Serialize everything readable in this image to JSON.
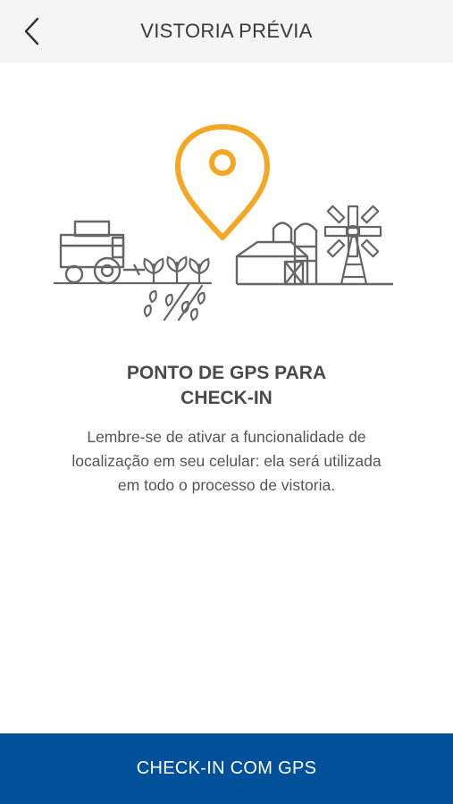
{
  "header": {
    "title": "VISTORIA PRÉVIA",
    "back_icon": "chevron-left-icon"
  },
  "content": {
    "illustration_icons": [
      "map-pin-icon",
      "harvester-icon",
      "crops-icon",
      "farmhouse-icon",
      "silo-icon",
      "windmill-icon"
    ],
    "heading_line1": "PONTO DE GPS PARA",
    "heading_line2": "CHECK-IN",
    "description_line1": "Lembre-se de ativar a funcionalidade de",
    "description_line2": "localização em seu celular: ela será utilizada",
    "description_line3": "em todo o processo de vistoria."
  },
  "footer": {
    "cta_label": "CHECK-IN COM GPS"
  },
  "colors": {
    "header_bg": "#f5f5f5",
    "accent": "#f5a623",
    "primary": "#00509a",
    "illustration_line": "#666666"
  }
}
